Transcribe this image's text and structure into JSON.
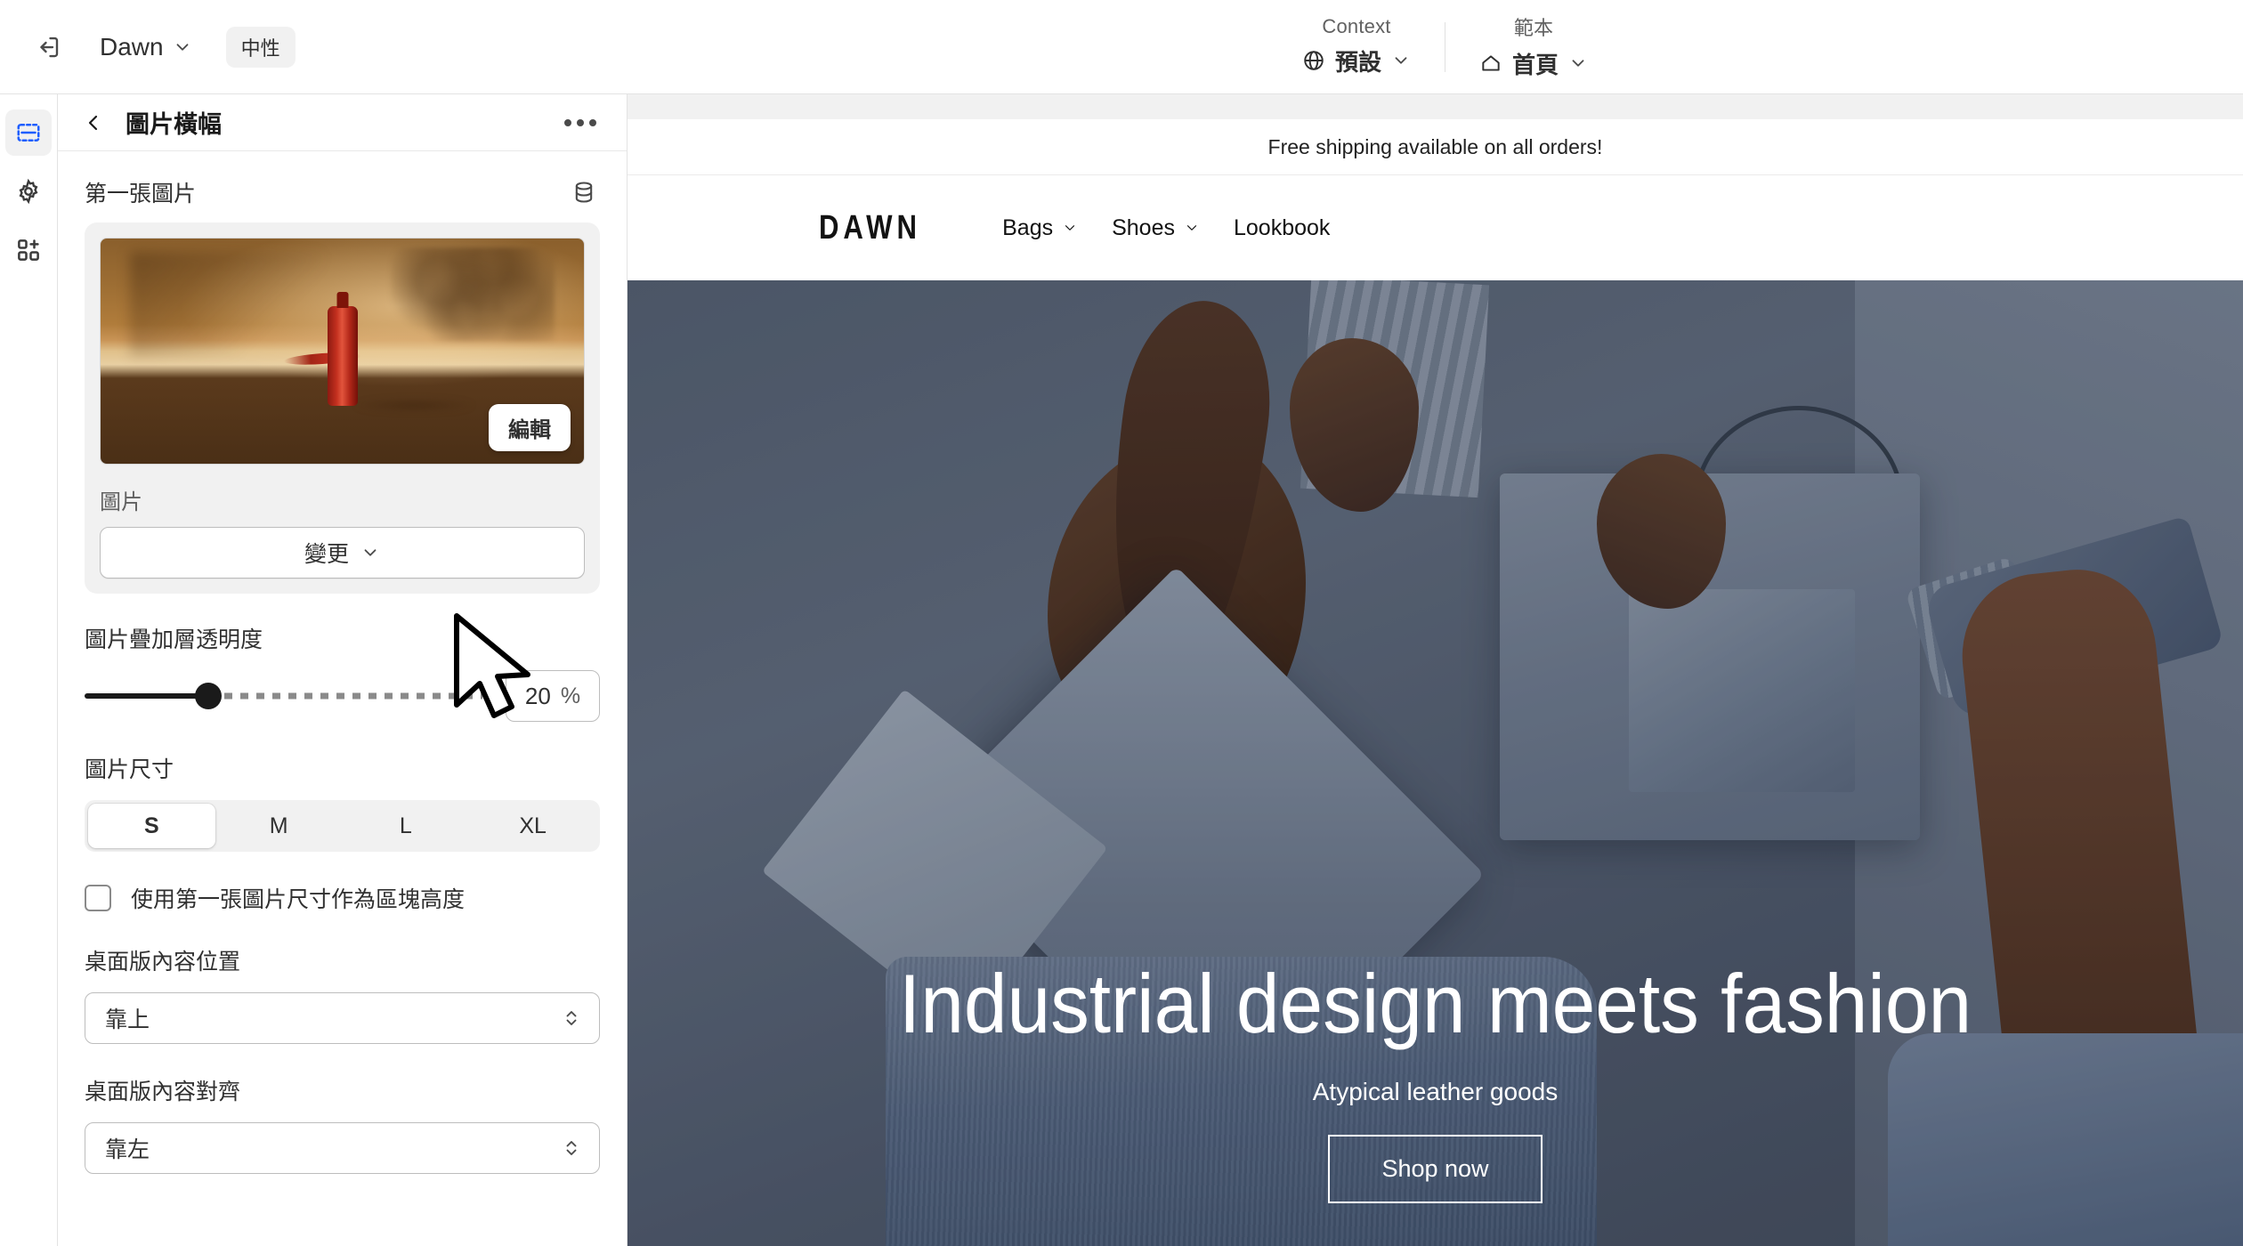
{
  "topbar": {
    "exit_icon": "exit-icon",
    "theme_name": "Dawn",
    "theme_badge": "中性",
    "context": {
      "label": "Context",
      "icon": "globe-icon",
      "value": "預設"
    },
    "template": {
      "label": "範本",
      "icon": "home-icon",
      "value": "首頁"
    }
  },
  "rail": {
    "items": [
      {
        "name": "sections-icon",
        "label": "區段"
      },
      {
        "name": "gear-icon",
        "label": "設定"
      },
      {
        "name": "apps-add-icon",
        "label": "應用程式"
      }
    ]
  },
  "panel": {
    "back_icon": "chevron-left-icon",
    "title": "圖片橫幅",
    "more_icon": "ellipsis-icon",
    "first_image": {
      "label": "第一張圖片",
      "db_icon": "database-icon",
      "edit_button": "編輯",
      "image_label": "圖片",
      "change_button": "變更"
    },
    "overlay_opacity": {
      "label": "圖片疊加層透明度",
      "value": "20",
      "unit": "%",
      "fill_percent": 31
    },
    "image_size": {
      "label": "圖片尺寸",
      "options": [
        "S",
        "M",
        "L",
        "XL"
      ],
      "selected": "S"
    },
    "use_first_image_height": {
      "label": "使用第一張圖片尺寸作為區塊高度",
      "checked": false
    },
    "desktop_content_position": {
      "label": "桌面版內容位置",
      "value": "靠上"
    },
    "desktop_content_alignment": {
      "label": "桌面版內容對齊",
      "value": "靠左"
    }
  },
  "preview": {
    "announcement": "Free shipping available on all orders!",
    "store_logo": "DAWN",
    "nav": [
      {
        "label": "Bags",
        "has_dropdown": true
      },
      {
        "label": "Shoes",
        "has_dropdown": true
      },
      {
        "label": "Lookbook",
        "has_dropdown": false
      }
    ],
    "hero": {
      "title": "Industrial design meets fashion",
      "subtitle": "Atypical leather goods",
      "button": "Shop now"
    }
  },
  "colors": {
    "accent_blue": "#1f5eff",
    "text_primary": "#303030",
    "text_secondary": "#616161",
    "panel_bg": "#ffffff",
    "canvas_bg": "#f1f1f1",
    "border": "#e3e3e3"
  }
}
